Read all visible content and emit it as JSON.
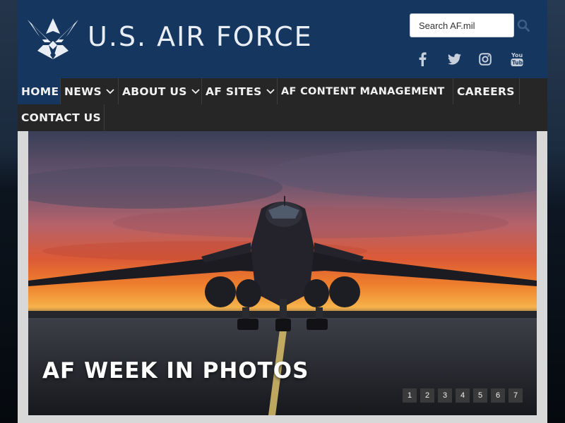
{
  "header": {
    "brand": "U.S. AIR FORCE",
    "logo_icon": "usaf-wings-logo",
    "search_placeholder": "Search AF.mil",
    "search_icon": "search-icon",
    "social": [
      {
        "name": "facebook-icon"
      },
      {
        "name": "twitter-icon"
      },
      {
        "name": "instagram-icon"
      },
      {
        "name": "youtube-icon"
      }
    ]
  },
  "nav": {
    "items": [
      {
        "label": "HOME",
        "active": true,
        "dropdown": false
      },
      {
        "label": "NEWS",
        "dropdown": true
      },
      {
        "label": "ABOUT US",
        "dropdown": true
      },
      {
        "label": "AF SITES",
        "dropdown": true
      },
      {
        "label": "AF CONTENT MANAGEMENT",
        "dropdown": false
      },
      {
        "label": "CAREERS",
        "dropdown": false
      },
      {
        "label": "CONTACT US",
        "dropdown": false
      }
    ]
  },
  "hero": {
    "title": "AF WEEK IN PHOTOS",
    "pages": [
      "1",
      "2",
      "3",
      "4",
      "5",
      "6",
      "7"
    ]
  },
  "colors": {
    "header_bg": "#14365f",
    "nav_bg": "#262626",
    "active_nav": "#14365f",
    "page_bg": "#d8d8d8"
  }
}
